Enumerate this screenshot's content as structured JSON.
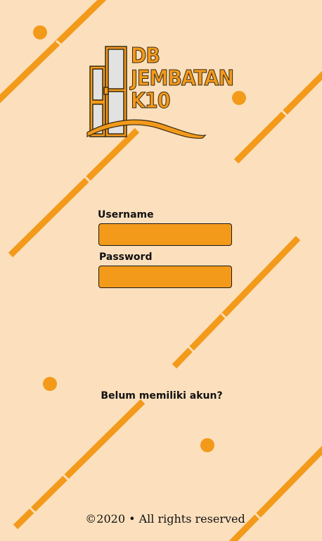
{
  "logo": {
    "line1": "DB",
    "line2": "JEMBATAN",
    "line3": "K10"
  },
  "form": {
    "username_label": "Username",
    "username_value": "",
    "password_label": "Password",
    "password_value": ""
  },
  "signup_link": "Belum memiliki akun?",
  "footer": "©2020 • All rights reserved",
  "colors": {
    "background": "#fce0bd",
    "accent": "#f39a1b",
    "outline": "#1a1a1a"
  }
}
